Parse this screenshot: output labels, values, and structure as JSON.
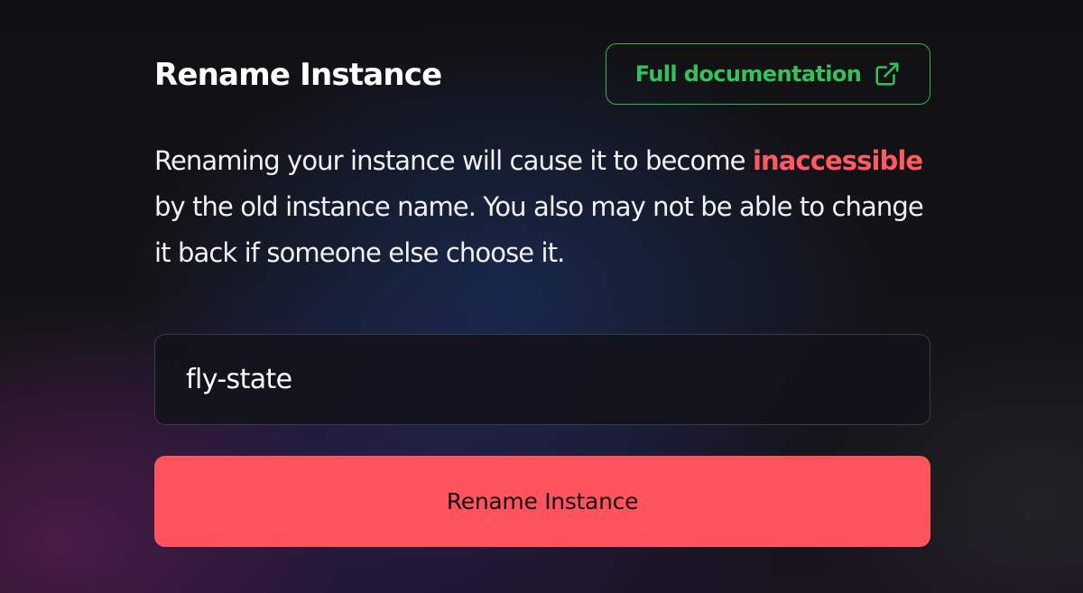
{
  "header": {
    "title": "Rename Instance",
    "doc_link_label": "Full documentation",
    "doc_link_icon": "external-link-icon"
  },
  "description": {
    "part1": "Renaming your instance will cause it to become ",
    "warning": "inaccessible",
    "part2": " by the old instance name. You also may not be able to change it back if someone else choose it."
  },
  "instance_input": {
    "value": "fly-state"
  },
  "rename_button": {
    "label": "Rename Instance"
  },
  "colors": {
    "accent_green": "#33c25a",
    "danger_red": "#ff545d",
    "background": "#131315"
  }
}
